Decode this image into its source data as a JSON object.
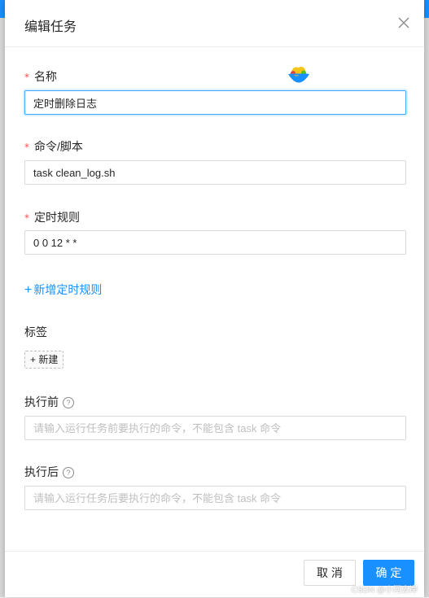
{
  "modal": {
    "title": "编辑任务",
    "close_icon": "close-icon"
  },
  "fields": {
    "name": {
      "required_mark": "*",
      "label": "名称",
      "value": "定时删除日志"
    },
    "command": {
      "required_mark": "*",
      "label": "命令/脚本",
      "value": "task clean_log.sh"
    },
    "schedule": {
      "required_mark": "*",
      "label": "定时规则",
      "value": "0 0 12 * *"
    },
    "add_rule": {
      "icon": "+",
      "label": "新增定时规则"
    },
    "tags": {
      "label": "标签",
      "add_icon": "+",
      "add_label": "新建"
    },
    "before": {
      "label": "执行前",
      "help_icon": "?",
      "placeholder": "请输入运行任务前要执行的命令，不能包含 task 命令"
    },
    "after": {
      "label": "执行后",
      "help_icon": "?",
      "placeholder": "请输入运行任务后要执行的命令，不能包含 task 命令"
    }
  },
  "footer": {
    "cancel_label": "取 消",
    "ok_label": "确 定"
  },
  "watermark": "CSDN @小河去岸",
  "colors": {
    "primary": "#1890ff",
    "required": "#ff4d4f",
    "border": "#d9d9d9"
  }
}
